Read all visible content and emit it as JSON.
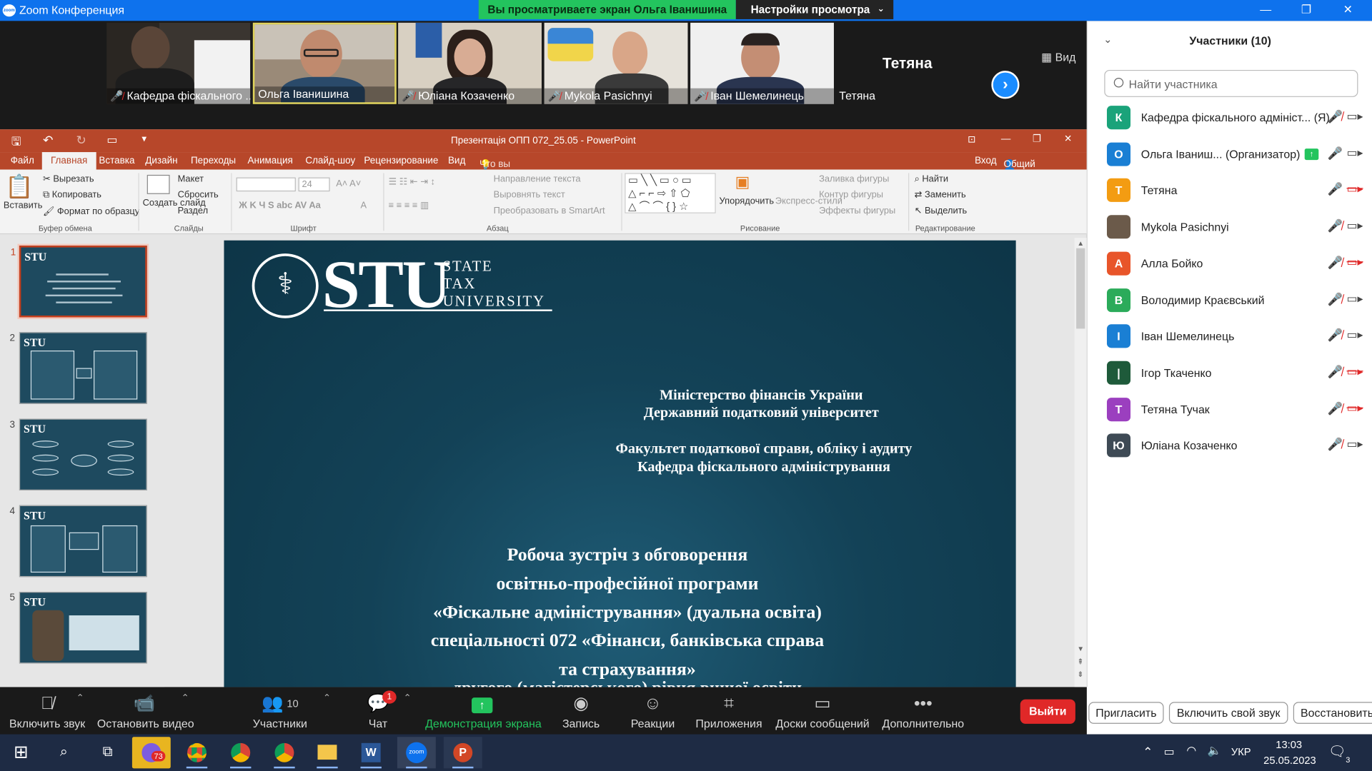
{
  "zoom": {
    "window_title": "Zoom Конференция",
    "logo_text": "zoom",
    "share_banner": "Вы просматриваете экран Ольга Іванишина",
    "view_settings": "Настройки просмотра",
    "view_button": "Вид"
  },
  "videos": [
    {
      "name": "Кафедра фіскального ...",
      "muted": true
    },
    {
      "name": "Ольга Іванишина",
      "muted": false,
      "active": true
    },
    {
      "name": "Юліана Козаченко",
      "muted": true
    },
    {
      "name": "Mykola Pasichnyi",
      "muted": true
    },
    {
      "name": "Іван Шемелинець",
      "muted": true
    },
    {
      "name": "Тетяна",
      "muted": false,
      "big_name": "Тетяна"
    }
  ],
  "ppt": {
    "title": "Презентація ОПП 072_25.05 - PowerPoint",
    "tabs": [
      "Файл",
      "Главная",
      "Вставка",
      "Дизайн",
      "Переходы",
      "Анимация",
      "Слайд-шоу",
      "Рецензирование",
      "Вид"
    ],
    "tell_me": "Что вы хотите сделать?",
    "signin": "Вход",
    "share": "Общий доступ",
    "ribbon": {
      "paste": "Вставить",
      "cut": "Вырезать",
      "copy": "Копировать",
      "format_painter": "Формат по образцу",
      "clipboard_group": "Буфер обмена",
      "new_slide": "Создать слайд",
      "layout": "Макет",
      "reset": "Сбросить",
      "section": "Раздел",
      "slides_group": "Слайды",
      "font_size": "24",
      "font_group": "Шрифт",
      "text_direction": "Направление текста",
      "align_text": "Выровнять текст",
      "smartart": "Преобразовать в SmartArt",
      "paragraph_group": "Абзац",
      "arrange": "Упорядочить",
      "quick_styles": "Экспресс-стили",
      "shape_fill": "Заливка фигуры",
      "shape_outline": "Контур фигуры",
      "shape_effects": "Эффекты фигуры",
      "drawing_group": "Рисование",
      "find": "Найти",
      "replace": "Заменить",
      "select": "Выделить",
      "editing_group": "Редактирование"
    },
    "thumbnails": [
      "1",
      "2",
      "3",
      "4",
      "5"
    ],
    "slide": {
      "logo": "STU",
      "logo_sub": [
        "STATE",
        "TAX",
        "UNIVERSITY"
      ],
      "ministry": "Міністерство фінансів України",
      "university": "Державний податковий університет",
      "faculty": "Факультет податкової справи, обліку і аудиту",
      "department": "Кафедра фіскального адміністрування",
      "lines": [
        "Робоча зустріч з обговорення",
        "освітньо-професійної програми",
        "«Фіскальне адміністрування» (дуальна освіта)",
        "спеціальності 072 «Фінанси, банківська справа",
        "та страхування»",
        "другого (магістерського) рівня вищої освіти"
      ]
    }
  },
  "participants": {
    "title": "Участники (10)",
    "search_placeholder": "Найти участника",
    "list": [
      {
        "initial": "К",
        "color": "#1aa37a",
        "name": "Кафедра фіскального адмініст... (Я)",
        "mic": "muted",
        "cam": "on"
      },
      {
        "initial": "О",
        "color": "#1a7fd4",
        "name": "Ольга Іваниш...  (Организатор)",
        "mic": "on",
        "cam": "on",
        "sharing": true
      },
      {
        "initial": "Т",
        "color": "#f39c12",
        "name": "Тетяна",
        "mic": "on",
        "cam": "off"
      },
      {
        "initial": "",
        "color": "#6b5a4a",
        "name": "Mykola Pasichnyi",
        "mic": "muted",
        "cam": "on"
      },
      {
        "initial": "А",
        "color": "#e8552a",
        "name": "Алла Бойко",
        "mic": "muted",
        "cam": "off"
      },
      {
        "initial": "В",
        "color": "#2bab5a",
        "name": "Володимир Краєвський",
        "mic": "muted",
        "cam": "on"
      },
      {
        "initial": "І",
        "color": "#1a7fd4",
        "name": "Іван Шемелинець",
        "mic": "muted",
        "cam": "on"
      },
      {
        "initial": "|",
        "color": "#1e5a3a",
        "name": "Ігор Ткаченко",
        "mic": "muted",
        "cam": "off"
      },
      {
        "initial": "Т",
        "color": "#9b3fbf",
        "name": "Тетяна Тучак",
        "mic": "muted",
        "cam": "off"
      },
      {
        "initial": "Ю",
        "color": "#3e4a55",
        "name": "Юліана Козаченко",
        "mic": "muted",
        "cam": "on"
      }
    ],
    "buttons": [
      "Пригласить",
      "Включить свой звук",
      "Восстановить"
    ]
  },
  "toolbar": {
    "unmute": "Включить звук",
    "stop_video": "Остановить видео",
    "participants": "Участники",
    "participants_count": "10",
    "chat": "Чат",
    "chat_badge": "1",
    "share": "Демонстрация экрана",
    "record": "Запись",
    "reactions": "Реакции",
    "apps": "Приложения",
    "whiteboards": "Доски сообщений",
    "more": "Дополнительно",
    "leave": "Выйти"
  },
  "taskbar": {
    "viber_badge": "73",
    "lang": "УКР",
    "time": "13:03",
    "date": "25.05.2023",
    "notif": "3",
    "zoom_label": "zoom"
  },
  "colors": {
    "zoom_blue": "#0e72ed",
    "ppt_red": "#b7472a",
    "green": "#23c45e",
    "leave_red": "#e02828"
  }
}
